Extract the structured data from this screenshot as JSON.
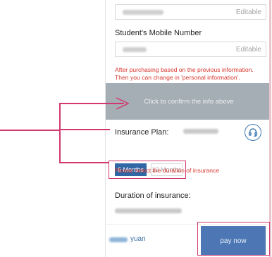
{
  "form": {
    "field1_editable": "Editable",
    "mobile_title": "Student's Mobile Number",
    "field2_editable": "Editable",
    "warning": "After purchasing based on the previous information. Then you can change in 'personal information'.",
    "confirm_label": "Click to confirm the info above"
  },
  "plan": {
    "label": "Insurance Plan:",
    "options": [
      "6 Months",
      "12 Months"
    ],
    "selected": "6 Months",
    "warning": "Please select the duration of insurance"
  },
  "duration": {
    "label": "Duration of insurance:"
  },
  "footer": {
    "price_suffix": "yuan",
    "pay_label": "pay now"
  },
  "colors": {
    "accent": "#3267a6",
    "warning": "#d8372f",
    "annotation": "#d2386f",
    "confirm_bg": "#a6aeb5"
  },
  "icons": {
    "support": "headset-icon"
  }
}
